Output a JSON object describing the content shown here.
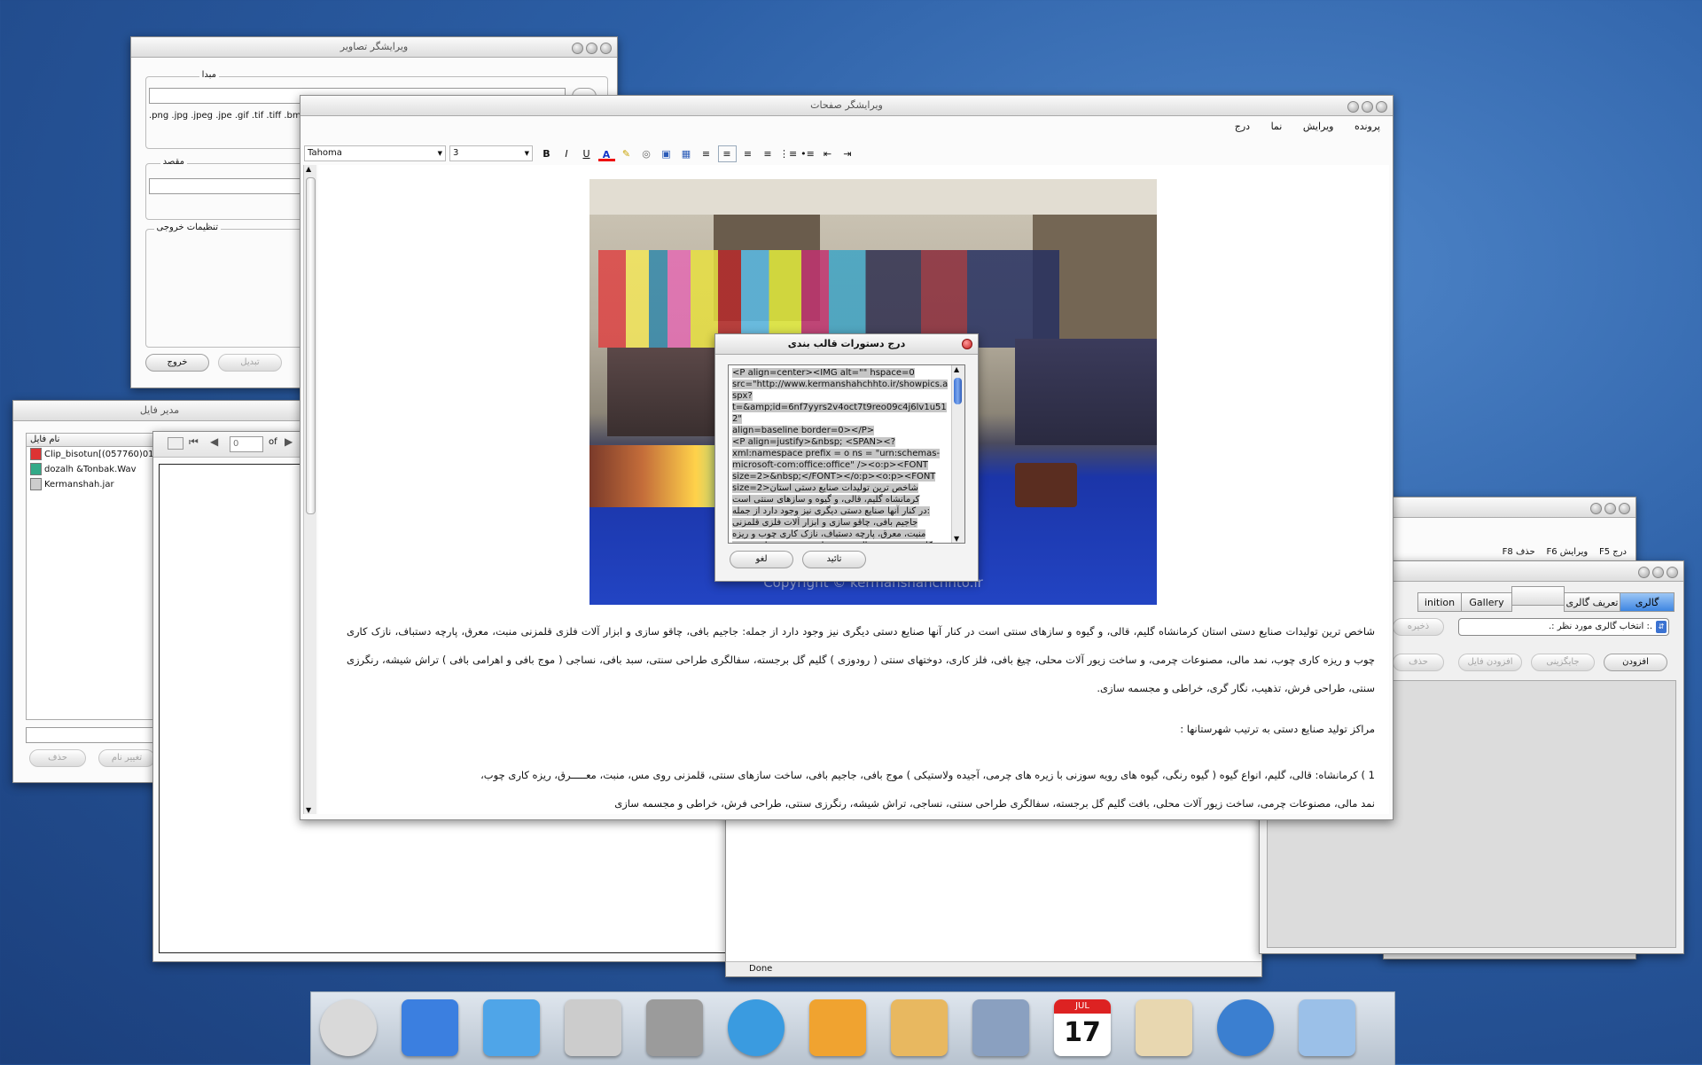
{
  "image_editor": {
    "title": "ویرایشگر تصاویر",
    "source_label": "مبدا",
    "formats": ".png .jpg .jpeg .jpe .gif .tif .tiff .bm",
    "dest_label": "مقصد",
    "output_label": "تنظیمات خروجی",
    "exit_button": "خروج",
    "convert_button": "تبدیل"
  },
  "file_manager": {
    "title": "مدیر فایل",
    "column": "نام فایل",
    "files": [
      "Clip_bisotun[(057760)01",
      "dozalh &Tonbak.Wav",
      "Kermanshah.jar"
    ],
    "delete_button": "حذف",
    "rename_button": "تغییر نام",
    "page_value": "0",
    "page_of": "of"
  },
  "page_editor": {
    "title": "ویرایشگر صفحات",
    "menu": [
      "پرونده",
      "ویرایش",
      "نما",
      "درج"
    ],
    "font_name": "Tahoma",
    "font_size": "3",
    "photo_caption": "Copyright © kermanshahchhto.ir",
    "paragraph1": "شاخص ترین تولیدات صنایع دستی استان کرمانشاه گلیم، قالی، و گیوه و سازهای سنتی است در کنار آنها صنایع دستی دیگری نیز وجود دارد از جمله: جاجیم بافی، چاقو سازی و ابزار آلات فلزی قلمزنی منبت، معرق، پارچه دستباف، نازک کاری چوب و ریزه کاری چوب، نمد مالی، مصنوعات چرمی، و ساخت زیور آلات محلی، چیغ بافی، فلز کاری، دوختهای سنتی ( رودوزی ) گلیم گل برجسته، سفالگری طراحی سنتی، سبد بافی، نساجی ( موج بافی و اهرامی بافی ) تراش شیشه، رنگرزی سنتی، طراحی فرش، تذهیب، نگار گری، خراطی و مجسمه سازی.",
    "paragraph2": "مراکز تولید صنایع دستی به ترتیب شهرستانها :",
    "paragraph3": "1 ) کرمانشاه: قالی، گلیم، انواع گیوه ( گیوه رنگی، گیوه های رویه سوزنی با زیره های چرمی، آجیده ولاستیکی ) موج بافی، جاجیم بافی، ساخت سازهای سنتی، قلمزنی روی مس، منبت، معـــــرق، ریزه کاری چوب،",
    "paragraph4": "نمد مالی، مصنوعات چرمی، ساخت زیور آلات محلی، بافت گلیم گل برجسته، سفالگری طراحی سنتی، نساجی، تراش شیشه، رنگرزی سنتی، طراحی فرش، خراطی و مجسمه سازی"
  },
  "insert_dialog": {
    "title": "درج دستورات قالب بندی",
    "code": "<P align=center><IMG alt=\"\" hspace=0\nsrc=\"http://www.kermanshahchhto.ir/showpics.aspx?\nt=&amp;id=6nf7yyrs2v4oct7t9reo09c4j6lv1u512\"\nalign=baseline border=0></P>\n<P align=justify>&nbsp; <SPAN><?\nxml:namespace prefix = o ns = \"urn:schemas-\nmicrosoft-com:office:office\" /><o:p><FONT\nsize=2>&nbsp;</FONT></o:p><o:p><FONT\nsize=2>شاخص ترین تولیدات صنایع دستی استان\nکرمانشاه گلیم، قالی، و گیوه و سازهای سنتی است\nدر کنار آنها صنایع دستی دیگری نیز وجود دارد از جمله:\nجاجیم بافی، چاقو سازی و ابزار آلات فلزی قلمزنی\nمنبت، معرق، پارچه دستباف، نازک کاری چوب و ریزه\nکاری چوب، نمد مالی، مصنوعات چرمی، و ساخت زیور",
    "ok_button": "تائید",
    "cancel_button": "لغو"
  },
  "menu_window": {
    "insert": "درج",
    "insert_key": "F5",
    "edit": "ویرایش",
    "edit_key": "F6",
    "delete": "حذف",
    "delete_key": "F8"
  },
  "gallery": {
    "tabs": [
      "گالری",
      "تعریف گالری",
      "",
      "Gallery",
      "inition"
    ],
    "select_placeholder": ".: انتخاب گالری مورد نظر :.",
    "save_button": "ذخیره",
    "add_button": "افزودن",
    "replace_button": "جایگزینی",
    "add_file_button": "افزودن فایل",
    "delete_button": "حذف"
  },
  "browser": {
    "status": "Done"
  },
  "dock": {
    "items": [
      "shutdown-icon",
      "finder-icon",
      "pictures-folder-icon",
      "keychain-icon",
      "system-preferences-icon",
      "safari-icon",
      "firewire-disk-icon",
      "textedit-icon",
      "disk-utility-icon",
      "ical-icon",
      "preview-icon",
      "network-utility-icon",
      "photos-icon"
    ],
    "calendar_month": "JUL",
    "calendar_day": "17"
  }
}
